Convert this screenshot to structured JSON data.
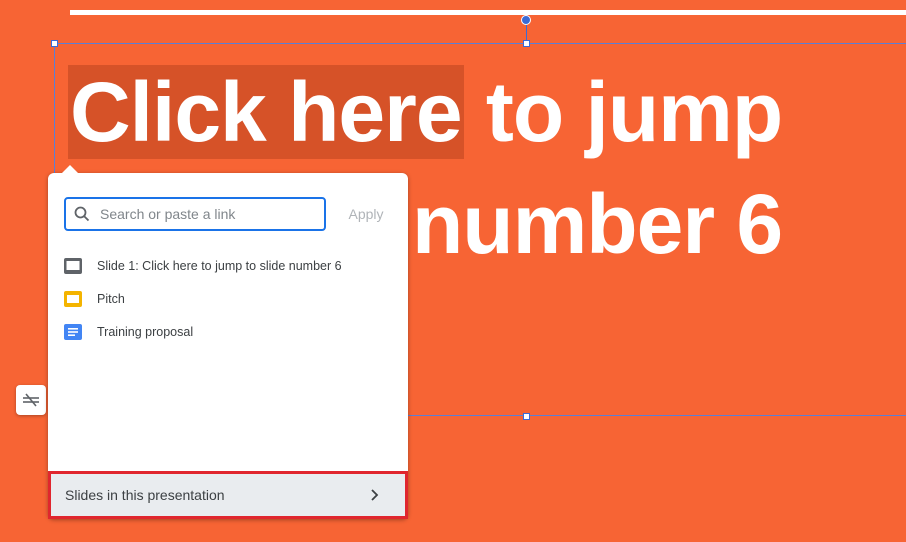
{
  "slide": {
    "text_highlighted": "Click here",
    "text_rest": " to jump",
    "text_line2": "number 6"
  },
  "link_popup": {
    "search_placeholder": "Search or paste a link",
    "apply_label": "Apply",
    "results": [
      {
        "icon": "slide-icon",
        "label": "Slide 1: Click here to jump to slide number 6"
      },
      {
        "icon": "slides-file-icon",
        "label": "Pitch"
      },
      {
        "icon": "docs-file-icon",
        "label": "Training proposal"
      }
    ],
    "footer_label": "Slides in this presentation"
  },
  "colors": {
    "slide_bg": "#f76434",
    "highlight": "#d65228",
    "accent": "#1a73e8",
    "footer_outline": "#e0262e"
  }
}
